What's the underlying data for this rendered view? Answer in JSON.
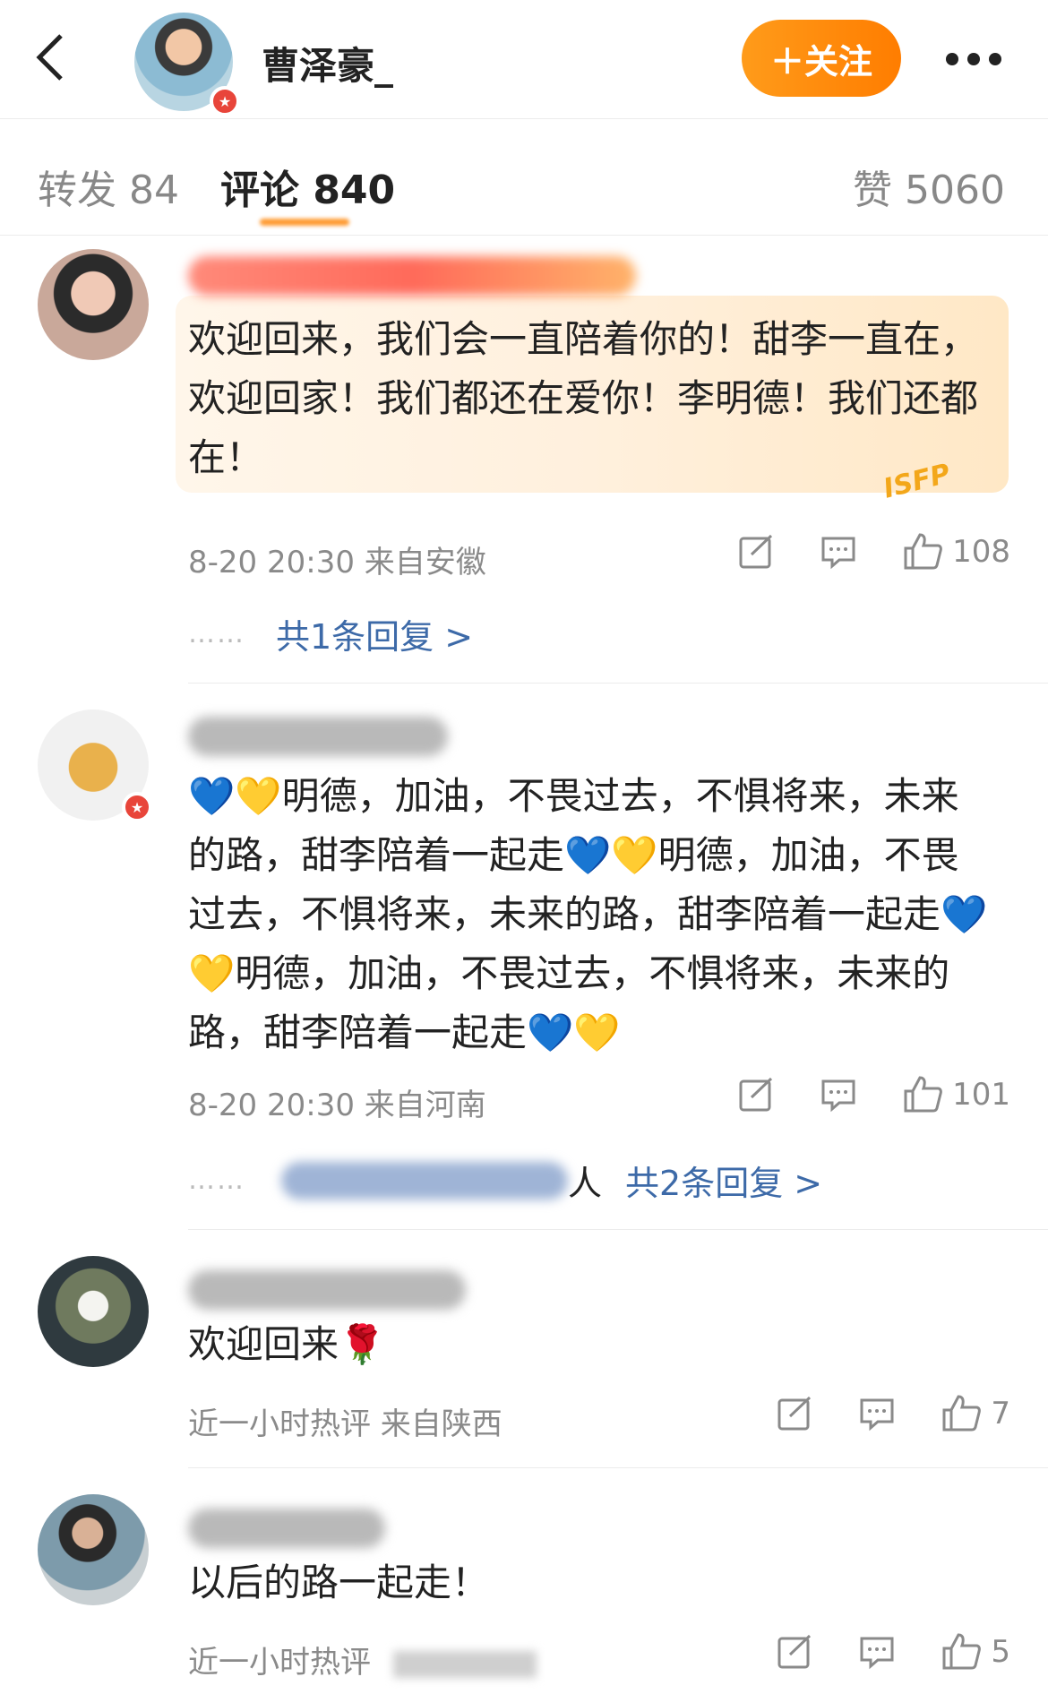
{
  "header": {
    "title": "曹泽豪_",
    "follow_label": "＋关注"
  },
  "tabs": {
    "repost": "转发 84",
    "comment": "评论 840",
    "like": "赞 5060"
  },
  "colors": {
    "accent": "#ff8200",
    "link": "#3d6aa8",
    "badge": "#e8453a"
  },
  "comments": [
    {
      "text": "欢迎回来，我们会一直陪着你的！甜李一直在，欢迎回家！我们都还在爱你！李明德！我们还都在！",
      "meta": "8-20 20:30 来自安徽",
      "likes": "108",
      "replies_label": "共1条回复 >",
      "decoration": "ISFP"
    },
    {
      "text_segments": [
        "💙💛",
        "明德，加油，不畏过去，不惧将来，未来的路，甜李陪着一起走",
        "💙💛",
        "明德，加油，不畏过去，不惧将来，未来的路，甜李陪着一起走",
        "💙💛",
        "明德，加油，不畏过去，不惧将来，未来的路，甜李陪着一起走",
        "💙💛"
      ],
      "meta": "8-20 20:30 来自河南",
      "likes": "101",
      "reply_person_suffix": "人",
      "replies_label": "共2条回复 >"
    },
    {
      "text": "欢迎回来🌹",
      "meta": "近一小时热评  来自陕西",
      "likes": "7"
    },
    {
      "text": "以后的路一起走！",
      "meta": "近一小时热评",
      "likes": "5"
    }
  ],
  "icons": [
    "back-arrow-icon",
    "verified-badge-icon",
    "more-dots-icon",
    "share-icon",
    "comment-icon",
    "thumbs-up-icon"
  ]
}
